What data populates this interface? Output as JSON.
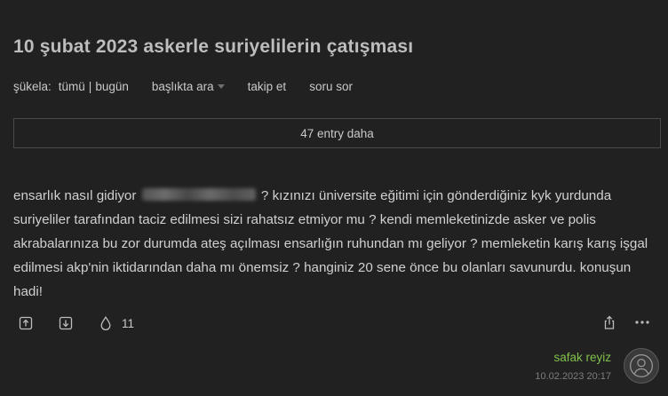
{
  "topic": {
    "title": "10 şubat 2023 askerle suriyelilerin çatışması"
  },
  "toolbar": {
    "sukela_label": "şükela:",
    "all_label": "tümü",
    "separator": "|",
    "today_label": "bugün",
    "search_label": "başlıkta ara",
    "follow_label": "takip et",
    "ask_label": "soru sor"
  },
  "more_entries": {
    "label": "47 entry daha"
  },
  "entry": {
    "text_before_blur": "ensarlık nasıl gidiyor",
    "text_after_blur": "? kızınızı üniversite eğitimi için gönderdiğiniz kyk yurdunda suriyeliler tarafından taciz edilmesi sizi rahatsız etmiyor mu ? kendi memleketinizde asker ve polis akrabalarınıza bu zor durumda ateş açılması ensarlığın ruhundan mı geliyor ? memleketin karış karış işgal edilmesi akp'nin iktidarından daha mı önemsiz ? hanginiz 20 sene önce bu olanları savunurdu. konuşun hadi!",
    "favorite_count": "11",
    "author": "safak reyiz",
    "date": "10.02.2023 20:17"
  },
  "colors": {
    "background": "#212121",
    "text": "#c9c9c9",
    "author": "#81c14b",
    "border": "#4a4a4a"
  },
  "icons": {
    "upvote": "arrow-up-in-square-icon",
    "downvote": "arrow-down-in-square-icon",
    "favorite": "drop-icon",
    "share": "share-icon",
    "more": "ellipsis-icon",
    "avatar": "user-icon"
  }
}
